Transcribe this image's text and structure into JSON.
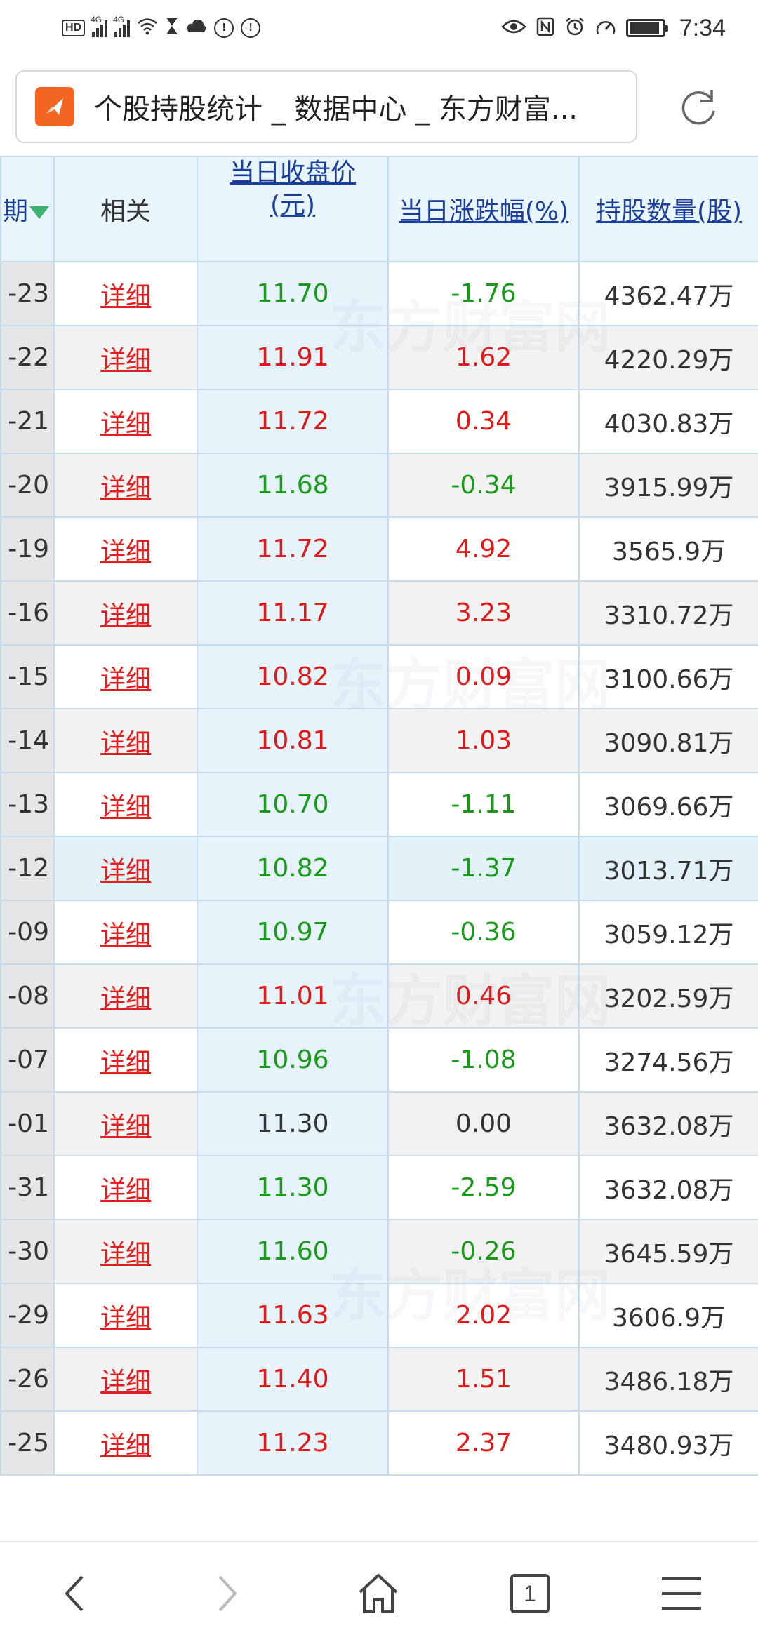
{
  "status_bar": {
    "time": "7:34",
    "hd": "HD",
    "net1": "4G",
    "net2": "4G"
  },
  "browser": {
    "page_title": "个股持股统计 _ 数据中心 _ 东方财富...",
    "tab_count": "1"
  },
  "table": {
    "headers": {
      "date_partial": "期",
      "related": "相关",
      "close_price": "当日收盘价(元)",
      "close_price_line1": "当日收盘价",
      "close_price_line2": "(元)",
      "change_pct": "当日涨跌幅(%)",
      "holding_qty": "持股数量(股)"
    },
    "rows": [
      {
        "date": "-23",
        "link": "详细",
        "price": "11.70",
        "change": "-1.76",
        "qty": "4362.47万",
        "trend": "down"
      },
      {
        "date": "-22",
        "link": "详细",
        "price": "11.91",
        "change": "1.62",
        "qty": "4220.29万",
        "trend": "up"
      },
      {
        "date": "-21",
        "link": "详细",
        "price": "11.72",
        "change": "0.34",
        "qty": "4030.83万",
        "trend": "up"
      },
      {
        "date": "-20",
        "link": "详细",
        "price": "11.68",
        "change": "-0.34",
        "qty": "3915.99万",
        "trend": "down"
      },
      {
        "date": "-19",
        "link": "详细",
        "price": "11.72",
        "change": "4.92",
        "qty": "3565.9万",
        "trend": "up"
      },
      {
        "date": "-16",
        "link": "详细",
        "price": "11.17",
        "change": "3.23",
        "qty": "3310.72万",
        "trend": "up"
      },
      {
        "date": "-15",
        "link": "详细",
        "price": "10.82",
        "change": "0.09",
        "qty": "3100.66万",
        "trend": "up"
      },
      {
        "date": "-14",
        "link": "详细",
        "price": "10.81",
        "change": "1.03",
        "qty": "3090.81万",
        "trend": "up"
      },
      {
        "date": "-13",
        "link": "详细",
        "price": "10.70",
        "change": "-1.11",
        "qty": "3069.66万",
        "trend": "down"
      },
      {
        "date": "-12",
        "link": "详细",
        "price": "10.82",
        "change": "-1.37",
        "qty": "3013.71万",
        "trend": "down"
      },
      {
        "date": "-09",
        "link": "详细",
        "price": "10.97",
        "change": "-0.36",
        "qty": "3059.12万",
        "trend": "down"
      },
      {
        "date": "-08",
        "link": "详细",
        "price": "11.01",
        "change": "0.46",
        "qty": "3202.59万",
        "trend": "up"
      },
      {
        "date": "-07",
        "link": "详细",
        "price": "10.96",
        "change": "-1.08",
        "qty": "3274.56万",
        "trend": "down"
      },
      {
        "date": "-01",
        "link": "详细",
        "price": "11.30",
        "change": "0.00",
        "qty": "3632.08万",
        "trend": "flat"
      },
      {
        "date": "-31",
        "link": "详细",
        "price": "11.30",
        "change": "-2.59",
        "qty": "3632.08万",
        "trend": "down"
      },
      {
        "date": "-30",
        "link": "详细",
        "price": "11.60",
        "change": "-0.26",
        "qty": "3645.59万",
        "trend": "down"
      },
      {
        "date": "-29",
        "link": "详细",
        "price": "11.63",
        "change": "2.02",
        "qty": "3606.9万",
        "trend": "up"
      },
      {
        "date": "-26",
        "link": "详细",
        "price": "11.40",
        "change": "1.51",
        "qty": "3486.18万",
        "trend": "up"
      },
      {
        "date": "-25",
        "link": "详细",
        "price": "11.23",
        "change": "2.37",
        "qty": "3480.93万",
        "trend": "up"
      }
    ]
  },
  "colors": {
    "up": "#e01818",
    "down": "#1a9a1a",
    "flat": "#333333",
    "link": "#e02020",
    "header_link": "#1a3e9c",
    "brand": "#f26522"
  },
  "icons": {
    "back": "chevron-left-icon",
    "forward": "chevron-right-icon",
    "home": "home-icon",
    "tabs": "tabs-icon",
    "menu": "menu-icon",
    "refresh": "refresh-icon"
  }
}
